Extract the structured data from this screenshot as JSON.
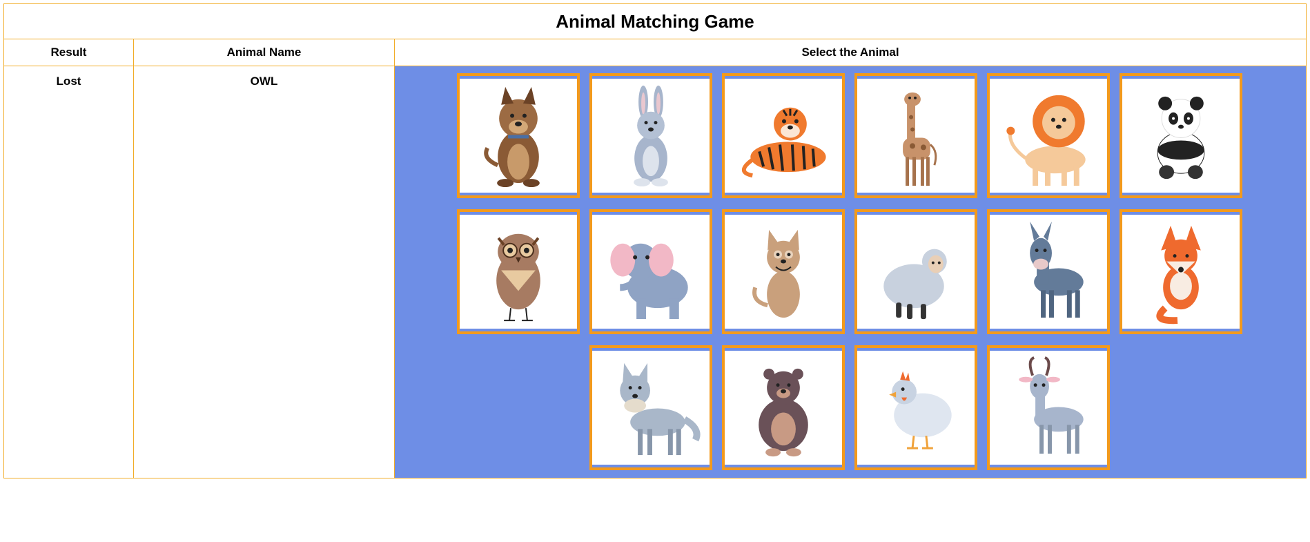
{
  "title": "Animal Matching Game",
  "headers": {
    "result": "Result",
    "animal_name": "Animal Name",
    "select": "Select the Animal"
  },
  "result": "Lost",
  "animal_name": "OWL",
  "colors": {
    "border": "#f1ac27",
    "board_bg": "#6e8ee6",
    "board_border": "#e22b2b",
    "card_border": "#f39a1c"
  },
  "cards": [
    {
      "animal": "dog"
    },
    {
      "animal": "rabbit"
    },
    {
      "animal": "tiger"
    },
    {
      "animal": "giraffe"
    },
    {
      "animal": "lion"
    },
    {
      "animal": "panda"
    },
    {
      "animal": "owl"
    },
    {
      "animal": "elephant"
    },
    {
      "animal": "cat"
    },
    {
      "animal": "sheep"
    },
    {
      "animal": "donkey"
    },
    {
      "animal": "fox"
    },
    {
      "animal": "wolf"
    },
    {
      "animal": "bear"
    },
    {
      "animal": "chicken"
    },
    {
      "animal": "goat"
    }
  ]
}
